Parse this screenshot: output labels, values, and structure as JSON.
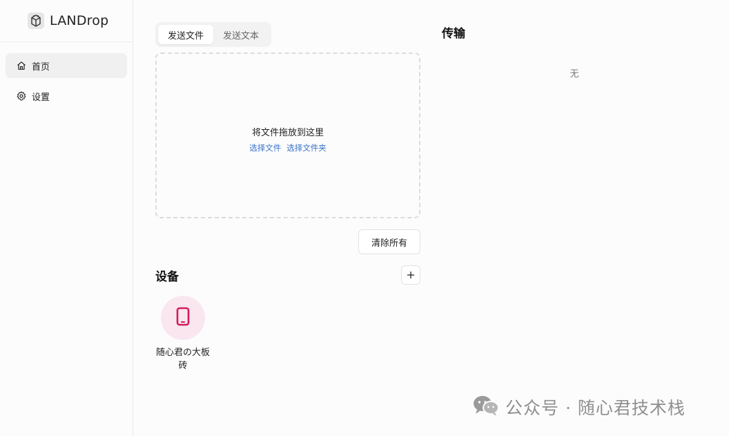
{
  "app": {
    "title": "LANDrop"
  },
  "sidebar": {
    "items": [
      {
        "label": "首页",
        "icon": "home-icon",
        "active": true
      },
      {
        "label": "设置",
        "icon": "gear-icon",
        "active": false
      }
    ]
  },
  "send": {
    "tabs": [
      {
        "label": "发送文件",
        "active": true
      },
      {
        "label": "发送文本",
        "active": false
      }
    ],
    "dropzone": {
      "hint": "将文件拖放到这里",
      "select_files": "选择文件",
      "select_folder": "选择文件夹"
    },
    "clear_all_label": "清除所有"
  },
  "devices": {
    "title": "设备",
    "add_icon": "plus-icon",
    "items": [
      {
        "name": "随心君の大板砖",
        "icon": "phone-icon",
        "accent": "#d6195b",
        "bg": "#f9e6ef"
      }
    ]
  },
  "transfer": {
    "title": "传输",
    "empty": "无"
  },
  "watermark": {
    "text": "公众号 · 随心君技术栈",
    "icon": "wechat-icon"
  },
  "colors": {
    "link": "#3b73c8",
    "device_accent": "#d6195b"
  }
}
